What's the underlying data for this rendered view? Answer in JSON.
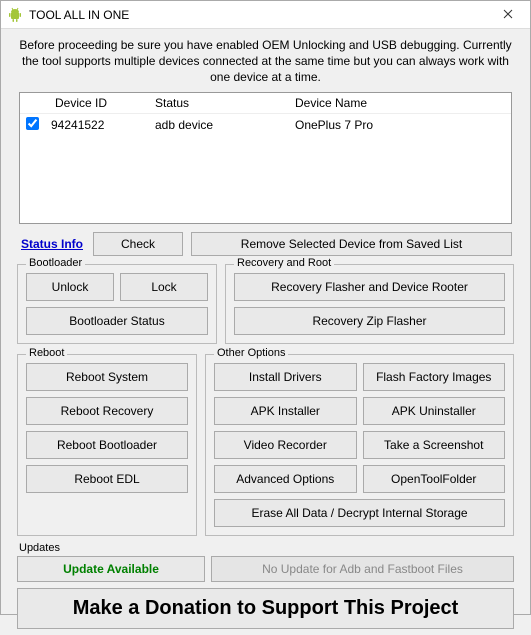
{
  "window": {
    "title": "TOOL ALL IN ONE"
  },
  "intro": "Before proceeding be sure you have enabled OEM Unlocking and USB debugging. Currently the tool supports multiple devices connected at the same time but you can always work with one device at a time.",
  "table": {
    "headers": {
      "check": "",
      "id": "Device ID",
      "status": "Status",
      "name": "Device Name"
    },
    "rows": [
      {
        "checked": true,
        "id": "94241522",
        "status": "adb device",
        "name": "OnePlus 7 Pro"
      }
    ]
  },
  "actions": {
    "status_info": "Status Info",
    "check": "Check",
    "remove": "Remove Selected Device from Saved List"
  },
  "bootloader": {
    "legend": "Bootloader",
    "unlock": "Unlock",
    "lock": "Lock",
    "status": "Bootloader Status"
  },
  "recovery": {
    "legend": "Recovery and Root",
    "flasher": "Recovery Flasher and Device Rooter",
    "zip": "Recovery Zip Flasher"
  },
  "reboot": {
    "legend": "Reboot",
    "system": "Reboot System",
    "recovery": "Reboot Recovery",
    "bootloader": "Reboot Bootloader",
    "edl": "Reboot EDL"
  },
  "other": {
    "legend": "Other Options",
    "install_drivers": "Install Drivers",
    "flash_factory": "Flash Factory Images",
    "apk_installer": "APK Installer",
    "apk_uninstaller": "APK Uninstaller",
    "video_recorder": "Video Recorder",
    "screenshot": "Take a Screenshot",
    "advanced": "Advanced Options",
    "open_folder": "OpenToolFolder",
    "erase": "Erase All Data / Decrypt Internal Storage"
  },
  "updates": {
    "legend": "Updates",
    "available": "Update Available",
    "no_update": "No Update for Adb and Fastboot Files"
  },
  "donate": "Make a Donation to Support This Project"
}
